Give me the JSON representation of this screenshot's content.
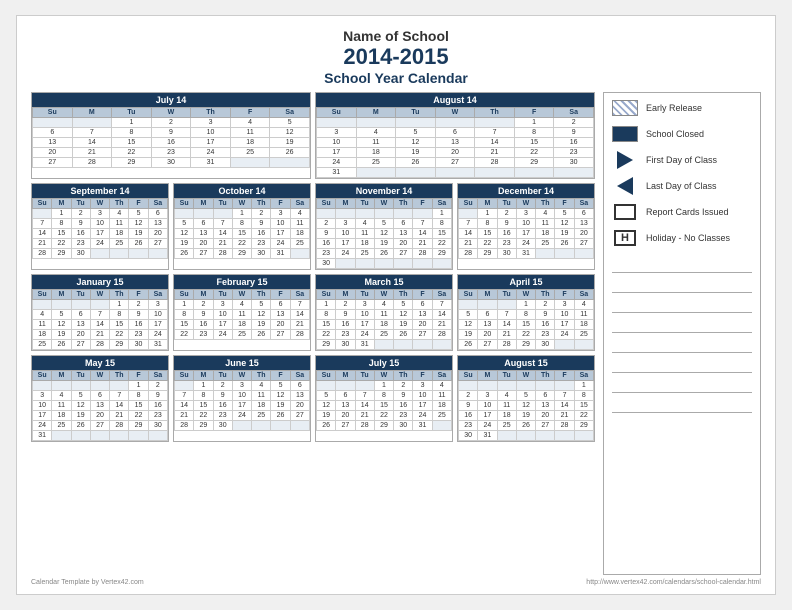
{
  "header": {
    "school_name": "Name of School",
    "year": "2014-2015",
    "subtitle": "School Year Calendar"
  },
  "legend": {
    "items": [
      {
        "icon": "hatch",
        "label": "Early Release"
      },
      {
        "icon": "solid",
        "label": "School Closed"
      },
      {
        "icon": "triangle-right",
        "label": "First Day of Class"
      },
      {
        "icon": "triangle-left",
        "label": "Last Day of Class"
      },
      {
        "icon": "empty-box",
        "label": "Report Cards Issued"
      },
      {
        "icon": "h-box",
        "label": "Holiday - No Classes"
      }
    ]
  },
  "footer": {
    "left": "Calendar Template by Vertex42.com",
    "right": "http://www.vertex42.com/calendars/school-calendar.html"
  },
  "months": [
    {
      "name": "July 14",
      "days_header": [
        "Su",
        "M",
        "Tu",
        "W",
        "Th",
        "F",
        "Sa"
      ],
      "weeks": [
        [
          "",
          "",
          "1",
          "2",
          "3",
          "4",
          "5"
        ],
        [
          "6",
          "7",
          "8",
          "9",
          "10",
          "11",
          "12"
        ],
        [
          "13",
          "14",
          "15",
          "16",
          "17",
          "18",
          "19"
        ],
        [
          "20",
          "21",
          "22",
          "23",
          "24",
          "25",
          "26"
        ],
        [
          "27",
          "28",
          "29",
          "30",
          "31",
          "",
          ""
        ]
      ]
    },
    {
      "name": "August 14",
      "days_header": [
        "Su",
        "M",
        "Tu",
        "W",
        "Th",
        "F",
        "Sa"
      ],
      "weeks": [
        [
          "",
          "",
          "",
          "",
          "",
          "1",
          "2"
        ],
        [
          "3",
          "4",
          "5",
          "6",
          "7",
          "8",
          "9"
        ],
        [
          "10",
          "11",
          "12",
          "13",
          "14",
          "15",
          "16"
        ],
        [
          "17",
          "18",
          "19",
          "20",
          "21",
          "22",
          "23"
        ],
        [
          "24",
          "25",
          "26",
          "27",
          "28",
          "29",
          "30"
        ],
        [
          "31",
          "",
          "",
          "",
          "",
          "",
          ""
        ]
      ]
    },
    {
      "name": "September 14",
      "days_header": [
        "Su",
        "M",
        "Tu",
        "W",
        "Th",
        "F",
        "Sa"
      ],
      "weeks": [
        [
          "",
          "1",
          "2",
          "3",
          "4",
          "5",
          "6"
        ],
        [
          "7",
          "8",
          "9",
          "10",
          "11",
          "12",
          "13"
        ],
        [
          "14",
          "15",
          "16",
          "17",
          "18",
          "19",
          "20"
        ],
        [
          "21",
          "22",
          "23",
          "24",
          "25",
          "26",
          "27"
        ],
        [
          "28",
          "29",
          "30",
          "",
          "",
          "",
          ""
        ]
      ]
    },
    {
      "name": "October 14",
      "days_header": [
        "Su",
        "M",
        "Tu",
        "W",
        "Th",
        "F",
        "Sa"
      ],
      "weeks": [
        [
          "",
          "",
          "",
          "1",
          "2",
          "3",
          "4"
        ],
        [
          "5",
          "6",
          "7",
          "8",
          "9",
          "10",
          "11"
        ],
        [
          "12",
          "13",
          "14",
          "15",
          "16",
          "17",
          "18"
        ],
        [
          "19",
          "20",
          "21",
          "22",
          "23",
          "24",
          "25"
        ],
        [
          "26",
          "27",
          "28",
          "29",
          "30",
          "31",
          ""
        ]
      ]
    },
    {
      "name": "November 14",
      "days_header": [
        "Su",
        "M",
        "Tu",
        "W",
        "Th",
        "F",
        "Sa"
      ],
      "weeks": [
        [
          "",
          "",
          "",
          "",
          "",
          "",
          "1"
        ],
        [
          "2",
          "3",
          "4",
          "5",
          "6",
          "7",
          "8"
        ],
        [
          "9",
          "10",
          "11",
          "12",
          "13",
          "14",
          "15"
        ],
        [
          "16",
          "17",
          "18",
          "19",
          "20",
          "21",
          "22"
        ],
        [
          "23",
          "24",
          "25",
          "26",
          "27",
          "28",
          "29"
        ],
        [
          "30",
          "",
          "",
          "",
          "",
          "",
          ""
        ]
      ]
    },
    {
      "name": "December 14",
      "days_header": [
        "Su",
        "M",
        "Tu",
        "W",
        "Th",
        "F",
        "Sa"
      ],
      "weeks": [
        [
          "",
          "1",
          "2",
          "3",
          "4",
          "5",
          "6"
        ],
        [
          "7",
          "8",
          "9",
          "10",
          "11",
          "12",
          "13"
        ],
        [
          "14",
          "15",
          "16",
          "17",
          "18",
          "19",
          "20"
        ],
        [
          "21",
          "22",
          "23",
          "24",
          "25",
          "26",
          "27"
        ],
        [
          "28",
          "29",
          "30",
          "31",
          "",
          "",
          ""
        ]
      ]
    },
    {
      "name": "January 15",
      "days_header": [
        "Su",
        "M",
        "Tu",
        "W",
        "Th",
        "F",
        "Sa"
      ],
      "weeks": [
        [
          "",
          "",
          "",
          "",
          "1",
          "2",
          "3"
        ],
        [
          "4",
          "5",
          "6",
          "7",
          "8",
          "9",
          "10"
        ],
        [
          "11",
          "12",
          "13",
          "14",
          "15",
          "16",
          "17"
        ],
        [
          "18",
          "19",
          "20",
          "21",
          "22",
          "23",
          "24"
        ],
        [
          "25",
          "26",
          "27",
          "28",
          "29",
          "30",
          "31"
        ]
      ]
    },
    {
      "name": "February 15",
      "days_header": [
        "Su",
        "M",
        "Tu",
        "W",
        "Th",
        "F",
        "Sa"
      ],
      "weeks": [
        [
          "1",
          "2",
          "3",
          "4",
          "5",
          "6",
          "7"
        ],
        [
          "8",
          "9",
          "10",
          "11",
          "12",
          "13",
          "14"
        ],
        [
          "15",
          "16",
          "17",
          "18",
          "19",
          "20",
          "21"
        ],
        [
          "22",
          "23",
          "24",
          "25",
          "26",
          "27",
          "28"
        ]
      ]
    },
    {
      "name": "March 15",
      "days_header": [
        "Su",
        "M",
        "Tu",
        "W",
        "Th",
        "F",
        "Sa"
      ],
      "weeks": [
        [
          "1",
          "2",
          "3",
          "4",
          "5",
          "6",
          "7"
        ],
        [
          "8",
          "9",
          "10",
          "11",
          "12",
          "13",
          "14"
        ],
        [
          "15",
          "16",
          "17",
          "18",
          "19",
          "20",
          "21"
        ],
        [
          "22",
          "23",
          "24",
          "25",
          "26",
          "27",
          "28"
        ],
        [
          "29",
          "30",
          "31",
          "",
          "",
          "",
          ""
        ]
      ]
    },
    {
      "name": "April 15",
      "days_header": [
        "Su",
        "M",
        "Tu",
        "W",
        "Th",
        "F",
        "Sa"
      ],
      "weeks": [
        [
          "",
          "",
          "",
          "1",
          "2",
          "3",
          "4"
        ],
        [
          "5",
          "6",
          "7",
          "8",
          "9",
          "10",
          "11"
        ],
        [
          "12",
          "13",
          "14",
          "15",
          "16",
          "17",
          "18"
        ],
        [
          "19",
          "20",
          "21",
          "22",
          "23",
          "24",
          "25"
        ],
        [
          "26",
          "27",
          "28",
          "29",
          "30",
          "",
          ""
        ]
      ]
    },
    {
      "name": "May 15",
      "days_header": [
        "Su",
        "M",
        "Tu",
        "W",
        "Th",
        "F",
        "Sa"
      ],
      "weeks": [
        [
          "",
          "",
          "",
          "",
          "",
          "1",
          "2"
        ],
        [
          "3",
          "4",
          "5",
          "6",
          "7",
          "8",
          "9"
        ],
        [
          "10",
          "11",
          "12",
          "13",
          "14",
          "15",
          "16"
        ],
        [
          "17",
          "18",
          "19",
          "20",
          "21",
          "22",
          "23"
        ],
        [
          "24",
          "25",
          "26",
          "27",
          "28",
          "29",
          "30"
        ],
        [
          "31",
          "",
          "",
          "",
          "",
          "",
          ""
        ]
      ]
    },
    {
      "name": "June 15",
      "days_header": [
        "Su",
        "M",
        "Tu",
        "W",
        "Th",
        "F",
        "Sa"
      ],
      "weeks": [
        [
          "",
          "1",
          "2",
          "3",
          "4",
          "5",
          "6"
        ],
        [
          "7",
          "8",
          "9",
          "10",
          "11",
          "12",
          "13"
        ],
        [
          "14",
          "15",
          "16",
          "17",
          "18",
          "19",
          "20"
        ],
        [
          "21",
          "22",
          "23",
          "24",
          "25",
          "26",
          "27"
        ],
        [
          "28",
          "29",
          "30",
          "",
          "",
          "",
          ""
        ]
      ]
    },
    {
      "name": "July 15",
      "days_header": [
        "Su",
        "M",
        "Tu",
        "W",
        "Th",
        "F",
        "Sa"
      ],
      "weeks": [
        [
          "",
          "",
          "",
          "1",
          "2",
          "3",
          "4"
        ],
        [
          "5",
          "6",
          "7",
          "8",
          "9",
          "10",
          "11"
        ],
        [
          "12",
          "13",
          "14",
          "15",
          "16",
          "17",
          "18"
        ],
        [
          "19",
          "20",
          "21",
          "22",
          "23",
          "24",
          "25"
        ],
        [
          "26",
          "27",
          "28",
          "29",
          "30",
          "31",
          ""
        ]
      ]
    },
    {
      "name": "August 15",
      "days_header": [
        "Su",
        "M",
        "Tu",
        "W",
        "Th",
        "F",
        "Sa"
      ],
      "weeks": [
        [
          "",
          "",
          "",
          "",
          "",
          "",
          "1"
        ],
        [
          "2",
          "3",
          "4",
          "5",
          "6",
          "7",
          "8"
        ],
        [
          "9",
          "10",
          "11",
          "12",
          "13",
          "14",
          "15"
        ],
        [
          "16",
          "17",
          "18",
          "19",
          "20",
          "21",
          "22"
        ],
        [
          "23",
          "24",
          "25",
          "26",
          "27",
          "28",
          "29"
        ],
        [
          "30",
          "31",
          "",
          "",
          "",
          "",
          ""
        ]
      ]
    }
  ]
}
